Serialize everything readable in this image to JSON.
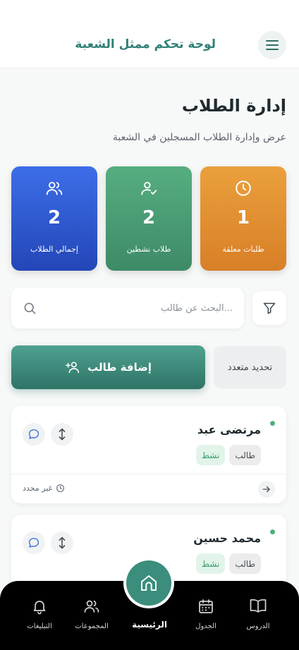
{
  "header": {
    "title": "لوحة تحكم ممثل الشعبة"
  },
  "page": {
    "title": "إدارة الطلاب",
    "subtitle": "عرض وإدارة الطلاب المسجلين في الشعبة"
  },
  "stats": [
    {
      "value": "2",
      "label": "إجمالي الطلاب",
      "color": "#2f5bd4",
      "icon": "users-icon"
    },
    {
      "value": "2",
      "label": "طلاب نشطين",
      "color": "#479b73",
      "icon": "user-check-icon"
    },
    {
      "value": "1",
      "label": "طلبات معلقة",
      "color": "#e08e30",
      "icon": "clock-icon"
    }
  ],
  "search": {
    "placeholder": "...البحث عن طالب"
  },
  "actions": {
    "add_label": "إضافة طالب",
    "multi_select_label": "تحديد متعدد"
  },
  "students": [
    {
      "name": "مرتضى عبد",
      "role": "طالب",
      "status": "نشط",
      "date_label": "غير محدد"
    },
    {
      "name": "محمد حسين",
      "role": "طالب",
      "status": "نشط"
    }
  ],
  "nav": {
    "lessons": "الدروس",
    "schedule": "الجدول",
    "home": "الرئيسية",
    "groups": "المجموعات",
    "notifications": "التبليغات"
  },
  "colors": {
    "accent": "#2f8077",
    "active_dot": "#4fb07a"
  }
}
